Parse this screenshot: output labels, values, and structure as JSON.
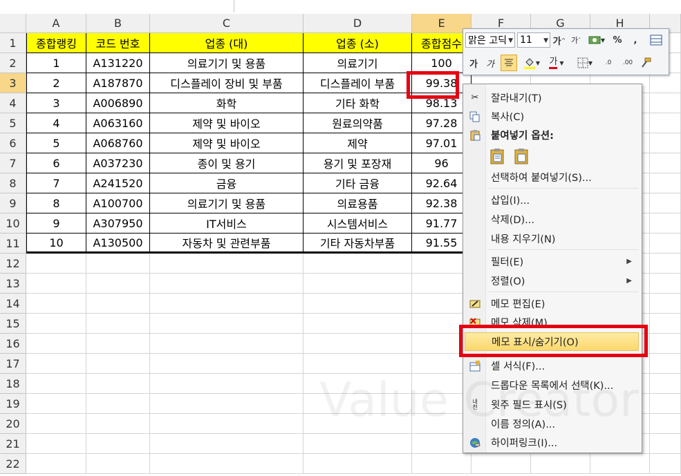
{
  "columns": [
    "A",
    "B",
    "C",
    "D",
    "E",
    "F",
    "G",
    "H"
  ],
  "rows": [
    "1",
    "2",
    "3",
    "4",
    "5",
    "6",
    "7",
    "8",
    "9",
    "10",
    "11",
    "12",
    "13",
    "14",
    "15",
    "16",
    "17",
    "18",
    "19",
    "20",
    "21",
    "22"
  ],
  "table_header": [
    "종합랭킹",
    "코드 번호",
    "업종 (대)",
    "업종 (소)",
    "종합점수"
  ],
  "table_rows": [
    [
      "1",
      "A131220",
      "의료기기 및 용품",
      "의료기기",
      "100"
    ],
    [
      "2",
      "A187870",
      "디스플레이 장비 및 부품",
      "디스플레이 부품",
      "99.38"
    ],
    [
      "3",
      "A006890",
      "화학",
      "기타 화학",
      "98.13"
    ],
    [
      "4",
      "A063160",
      "제약 및 바이오",
      "원료의약품",
      "97.28"
    ],
    [
      "5",
      "A068760",
      "제약 및 바이오",
      "제약",
      "97.01"
    ],
    [
      "6",
      "A037230",
      "종이 및 용기",
      "용기 및 포장재",
      "96"
    ],
    [
      "7",
      "A241520",
      "금융",
      "기타 금융",
      "92.64"
    ],
    [
      "8",
      "A100700",
      "의료기기 및 용품",
      "의료용품",
      "92.38"
    ],
    [
      "9",
      "A307950",
      "IT서비스",
      "시스템서비스",
      "91.77"
    ],
    [
      "10",
      "A130500",
      "자동차 및 관련부품",
      "기타 자동차부품",
      "91.55"
    ]
  ],
  "mini_toolbar": {
    "font_name": "맑은 고딕",
    "font_size": "11",
    "grow_font": "가",
    "shrink_font": "가",
    "percent": "%",
    "comma": ",",
    "bold": "가",
    "italic": "가",
    "font_color": "가",
    "dec_inc": ".0",
    "dec_dec": ".00"
  },
  "context_menu": {
    "cut": "잘라내기(T)",
    "copy": "복사(C)",
    "paste_options": "붙여넣기 옵션:",
    "paste_special": "선택하여 붙여넣기(S)...",
    "insert": "삽입(I)...",
    "delete": "삭제(D)...",
    "clear_contents": "내용 지우기(N)",
    "filter": "필터(E)",
    "sort": "정렬(O)",
    "edit_comment": "메모 편집(E)",
    "delete_comment": "메모 삭제(M)",
    "show_hide_comments": "메모 표시/숨기기(O)",
    "format_cells": "셀 서식(F)...",
    "pick_from_dropdown": "드롭다운 목록에서 선택(K)...",
    "phonetic_field": "윗주 필드 표시(S)",
    "define_name": "이름 정의(A)...",
    "hyperlink": "하이퍼링크(I)..."
  },
  "watermark": "Value Creator",
  "colors": {
    "header_fill": "#ffff00",
    "highlight_red": "#e60012",
    "selected_header": "#f8d68a"
  }
}
